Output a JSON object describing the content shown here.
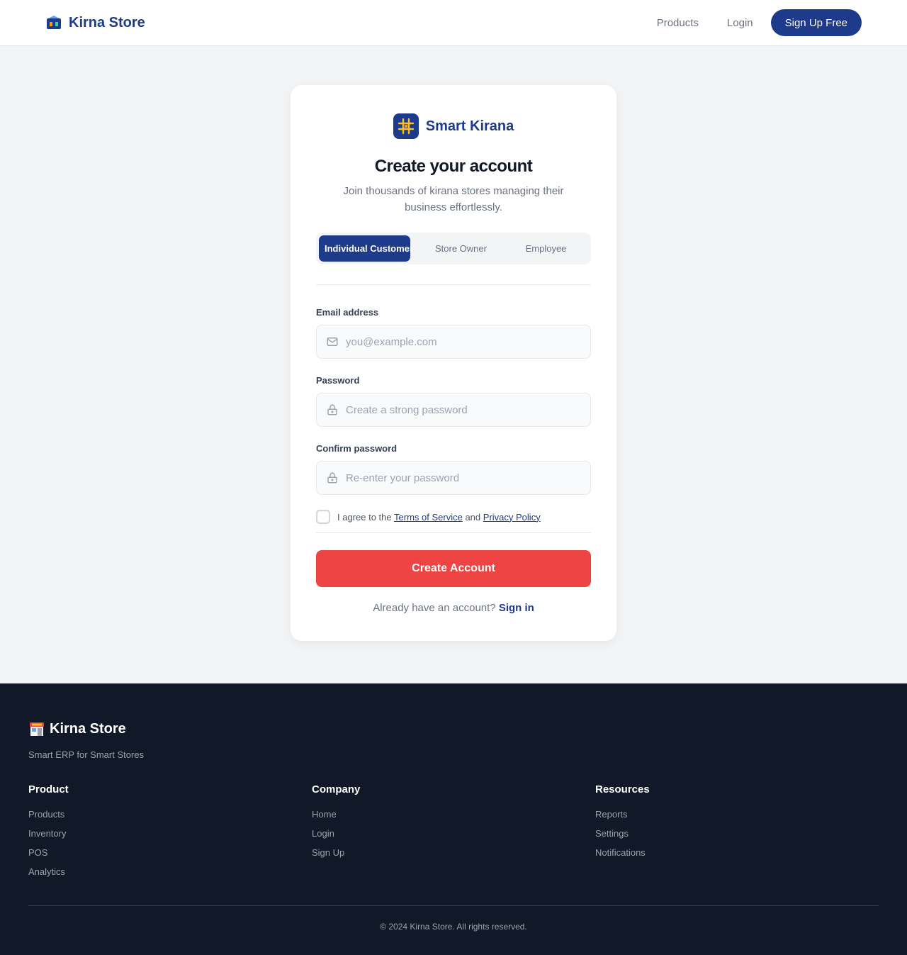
{
  "header": {
    "brand": "Kirna Store",
    "brand_icon": "storefront-icon",
    "nav": {
      "products": "Products",
      "login": "Login",
      "signup": "Sign Up Free"
    }
  },
  "card": {
    "logo_text": "Smart Kirana",
    "logo_icon": "kirana-grid-icon",
    "title": "Create your account",
    "subtitle": "Join thousands of kirana stores managing their business effortlessly.",
    "tabs": [
      {
        "label": "Individual Customer",
        "active": true
      },
      {
        "label": "Store Owner",
        "active": false
      },
      {
        "label": "Employee",
        "active": false
      }
    ],
    "email": {
      "label": "Email address",
      "placeholder": "you@example.com",
      "value": ""
    },
    "password": {
      "label": "Password",
      "placeholder": "Create a strong password",
      "value": ""
    },
    "confirm": {
      "label": "Confirm password",
      "placeholder": "Re-enter your password",
      "value": ""
    },
    "agree": {
      "prefix": "I agree to the",
      "terms": "Terms of Service",
      "middle": "and",
      "privacy": "Privacy Policy",
      "checked": false
    },
    "submit": "Create Account",
    "signin_prompt": "Already have an account?",
    "signin_link": "Sign in"
  },
  "footer": {
    "brand": "Kirna Store",
    "brand_icon": "convenience-store-icon",
    "tagline": "Smart ERP for Smart Stores",
    "columns": [
      {
        "title": "Product",
        "links": [
          "Products",
          "Inventory",
          "POS",
          "Analytics"
        ]
      },
      {
        "title": "Company",
        "links": [
          "Home",
          "Login",
          "Sign Up"
        ]
      },
      {
        "title": "Resources",
        "links": [
          "Reports",
          "Settings",
          "Notifications"
        ]
      }
    ],
    "copyright": "© 2024 Kirna Store. All rights reserved."
  },
  "colors": {
    "brand_navy": "#1e3a8a",
    "cta_red": "#ef4444",
    "page_bg": "#f3f4f6",
    "footer_bg": "#111827"
  }
}
